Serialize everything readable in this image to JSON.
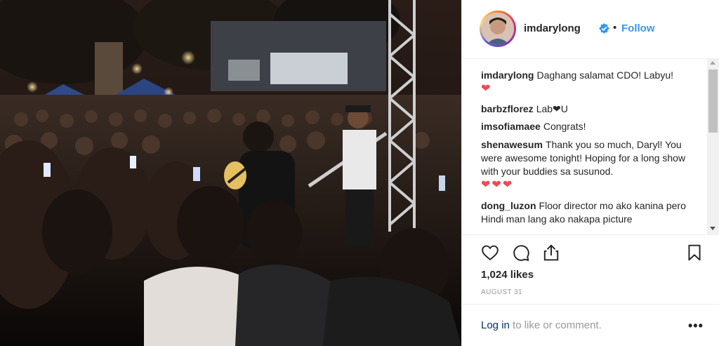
{
  "post": {
    "photo_description_icon": "concert-photo",
    "header": {
      "username": "imdarylong",
      "verified_icon": "verified-badge-icon",
      "separator": "•",
      "follow_label": "Follow"
    },
    "comments": [
      {
        "username": "imdarylong",
        "text": "Daghang salamat CDO! Labyu!",
        "hearts": "❤"
      },
      {
        "username": "barbzflorez",
        "text": "Lab❤U"
      },
      {
        "username": "imsofiamaee",
        "text": "Congrats!"
      },
      {
        "username": "shenawesum",
        "text": "Thank you so much, Daryl! You were awesome tonight! Hoping for a long show with your buddies sa susunod.",
        "hearts": "❤❤❤"
      },
      {
        "username": "dong_luzon",
        "text": "Floor director mo ako kanina pero Hindi man lang ako nakapa picture"
      }
    ],
    "actions": {
      "like_icon": "heart-icon",
      "comment_icon": "comment-icon",
      "share_icon": "share-icon",
      "save_icon": "bookmark-icon",
      "likes": "1,024 likes",
      "date": "AUGUST 31"
    },
    "footer": {
      "login_link": "Log in",
      "login_rest": " to like or comment.",
      "more_label": "•••"
    },
    "colors": {
      "accent": "#3897f0",
      "heart": "#ed4956",
      "muted": "#999999",
      "text": "#262626"
    }
  }
}
